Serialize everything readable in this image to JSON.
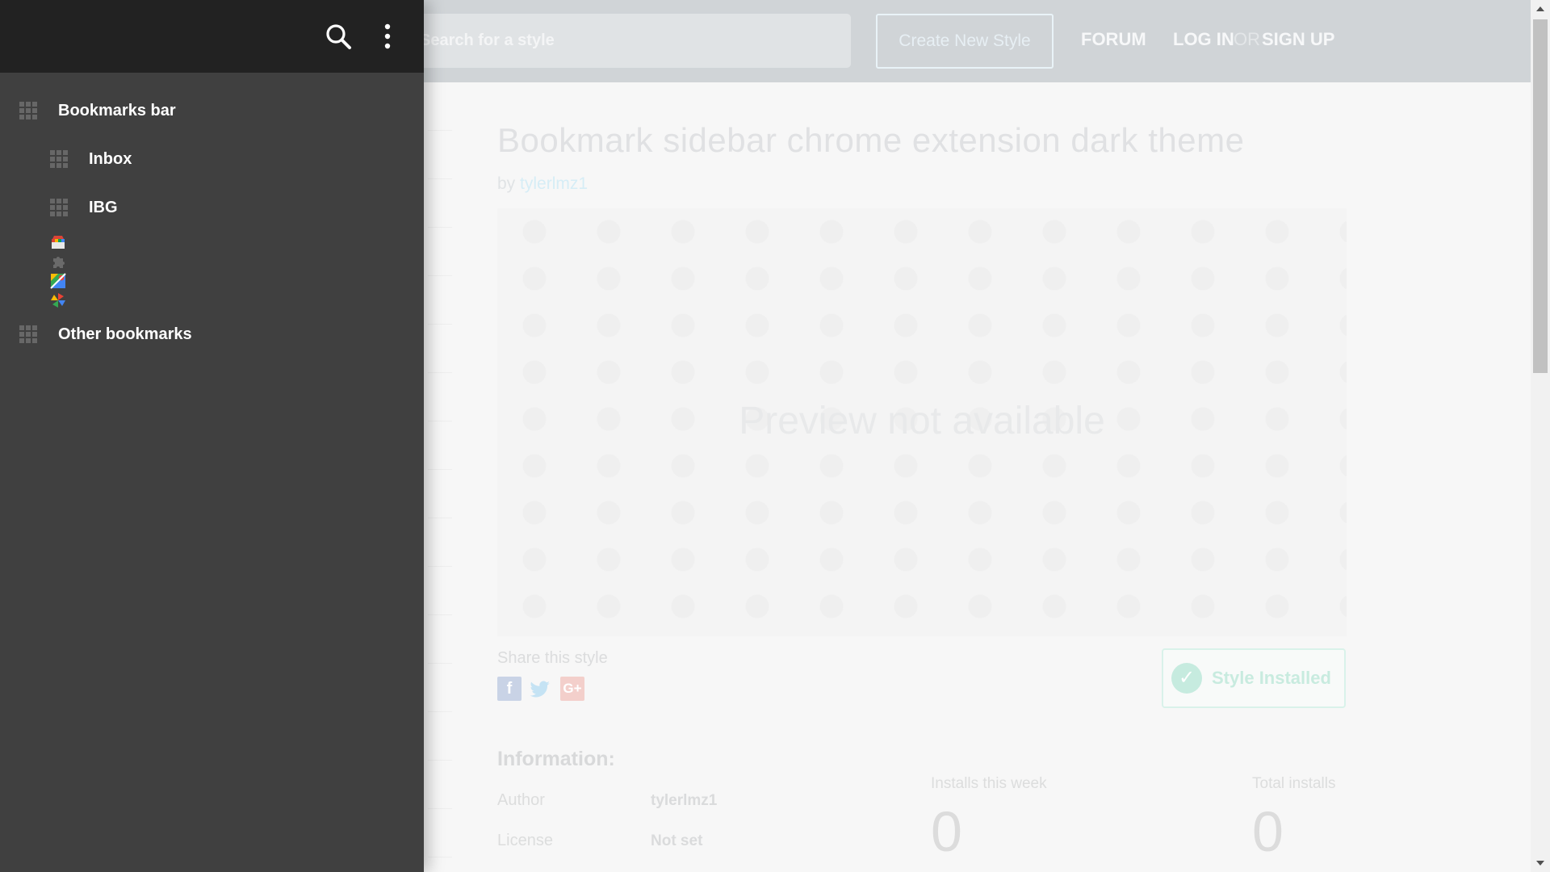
{
  "site": {
    "search": {
      "placeholder": "Search for a style"
    },
    "create_button": "Create New Style",
    "nav": {
      "forum": "FORUM",
      "login": "LOG IN",
      "or": "OR",
      "signup": "SIGN UP"
    }
  },
  "style_page": {
    "title": "Bookmark sidebar chrome extension dark theme",
    "by_prefix": "by",
    "author": "tylerlmz1",
    "preview_text": "Preview not available",
    "share_label": "Share this style",
    "share_icons": [
      "facebook-icon",
      "twitter-icon",
      "google-plus-icon"
    ],
    "installed_button": "Style Installed",
    "information": {
      "heading": "Information:",
      "author_label": "Author",
      "author_value": "tylerlmz1",
      "license_label": "License",
      "license_value": "Not set"
    },
    "stats": {
      "week_label": "Installs this week",
      "week_value": "0",
      "total_label": "Total installs",
      "total_value": "0"
    }
  },
  "sidebar": {
    "header_icons": [
      "search-icon",
      "more-vert-icon"
    ],
    "items": [
      {
        "label": "Bookmarks bar",
        "level": 0
      },
      {
        "label": "Inbox",
        "level": 1
      },
      {
        "label": "IBG",
        "level": 1
      },
      {
        "label": "Other bookmarks",
        "level": 0
      }
    ],
    "favicons": [
      "store-icon",
      "puzzle-icon",
      "maps-icon",
      "pinwheel-icon"
    ]
  },
  "colors": {
    "sidebar_bg": "#404040",
    "sidebar_header_bg": "#222222",
    "page_topbar_bg": "#d0d4d7"
  }
}
